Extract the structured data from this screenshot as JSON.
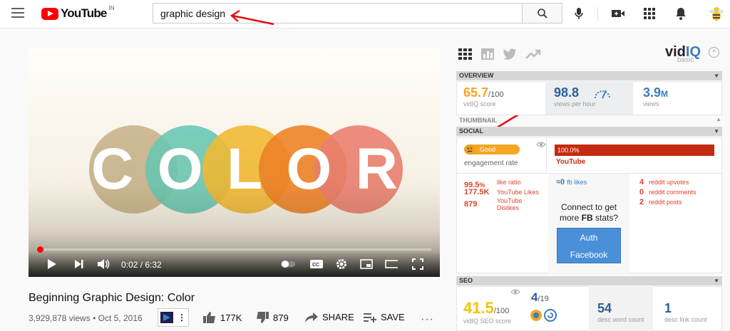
{
  "header": {
    "logo_text": "YouTube",
    "country": "IN",
    "search_value": "graphic design"
  },
  "video": {
    "overlay_word": [
      "C",
      "O",
      "L",
      "O",
      "R"
    ],
    "circle_colors": [
      "#cdbb98",
      "#6fd0c4",
      "#f7c23a",
      "#f48a2b",
      "#f0867b"
    ],
    "current_time": "0:02",
    "separator": " / ",
    "duration": "6:32",
    "title": "Beginning Graphic Design: Color",
    "views": "3,929,878 views",
    "dot": "•",
    "date": "Oct 5, 2016",
    "progress_pct": 1
  },
  "actions": {
    "likes": "177K",
    "dislikes": "879",
    "share": "SHARE",
    "save": "SAVE"
  },
  "vidiq": {
    "brand_a": "vid",
    "brand_b": "IQ",
    "plan": "basic",
    "overview_label": "OVERVIEW",
    "score_value": "65.7",
    "score_total": "/100",
    "score_label": "vidIQ score",
    "vph_value": "98.8",
    "vph_label": "views per hour",
    "views_value": "3.9",
    "views_suffix": "M",
    "views_label": "views",
    "thumbnail_label": "THUMBNAIL",
    "social_label": "SOCIAL",
    "engagement_badge": "Good",
    "engagement_label": "engagement rate",
    "yt_share": "100.0%",
    "yt_share_pct": 100,
    "yt_label": "YouTube",
    "like_ratio_value": "99.5",
    "like_ratio_unit": "%",
    "like_ratio_label": "like ratio",
    "likes_value": "177.5K",
    "likes_label": "YouTube Likes",
    "dislikes_value": "879",
    "dislikes_label_a": "YouTube",
    "dislikes_label_b": "Dislikes",
    "fb_value": "≈0",
    "fb_label": "fb likes",
    "connect_a": "Connect to get",
    "connect_b": "more",
    "connect_fb": "FB",
    "connect_c": "stats?",
    "auth_a": "Auth",
    "auth_b": "Facebook",
    "reddit_upvotes_value": "4",
    "reddit_upvotes_label": "reddit upvotes",
    "reddit_comments_value": "0",
    "reddit_comments_label": "reddit comments",
    "reddit_posts_value": "2",
    "reddit_posts_label": "reddit posts",
    "seo_label": "SEO",
    "seo_value": "41.5",
    "seo_total": "/100",
    "seo_score_label": "vidIQ SEO score",
    "tags_value": "4",
    "tags_total": "/19",
    "desc_words_value": "54",
    "desc_words_label": "desc word count",
    "desc_links_value": "1",
    "desc_links_label": "desc link count"
  },
  "colors": {
    "vidiq_orange": "#f5a623",
    "vidiq_blue": "#3d7dc1",
    "vidiq_red": "#d9452c",
    "yt_red": "#ff0000",
    "auth_blue": "#4a90d9"
  }
}
